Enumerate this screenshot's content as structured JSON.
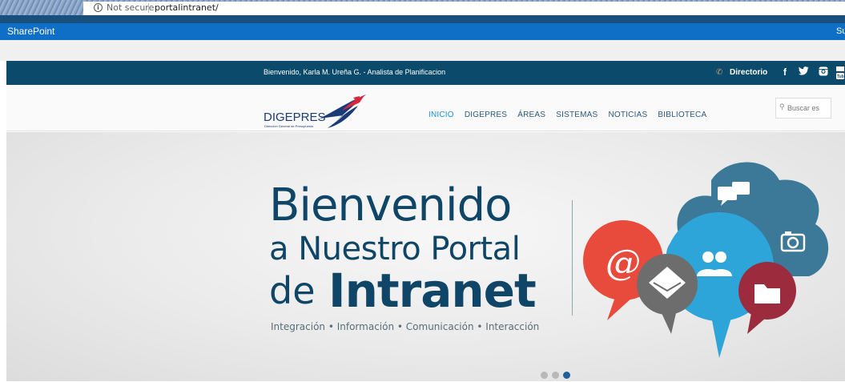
{
  "browser": {
    "security_text": "Not secure",
    "url": "portalintranet/"
  },
  "suite": {
    "brand": "SharePoint",
    "right_truncated": "Su"
  },
  "topbar": {
    "welcome": "Bienvenido, Karla M. Ureña G. - Analista de Planificacion",
    "directory": "Directorio",
    "social": [
      "f",
      "t",
      "ig",
      "yt"
    ]
  },
  "header": {
    "logo_text": "DIGEPRES",
    "logo_sub": "Dirección General de Presupuesto",
    "nav": [
      "INICIO",
      "DIGEPRES",
      "ÁREAS",
      "SISTEMAS",
      "NOTICIAS",
      "BIBLIOTECA"
    ],
    "active_nav": "INICIO",
    "search_placeholder": "Buscar es"
  },
  "hero": {
    "line1": "Bienvenido",
    "line2": "a Nuestro Portal",
    "line3a": "de",
    "line3b": "Intranet",
    "tagline": "Integración  •  Información  •  Comunicación  •  Interacción",
    "slides": 3,
    "active_slide": 3
  },
  "colors": {
    "suitebar": "#0f6fc6",
    "topbar": "#0b4a6a",
    "hero_text": "#0f4566",
    "nav_active": "#1a8fd8"
  }
}
